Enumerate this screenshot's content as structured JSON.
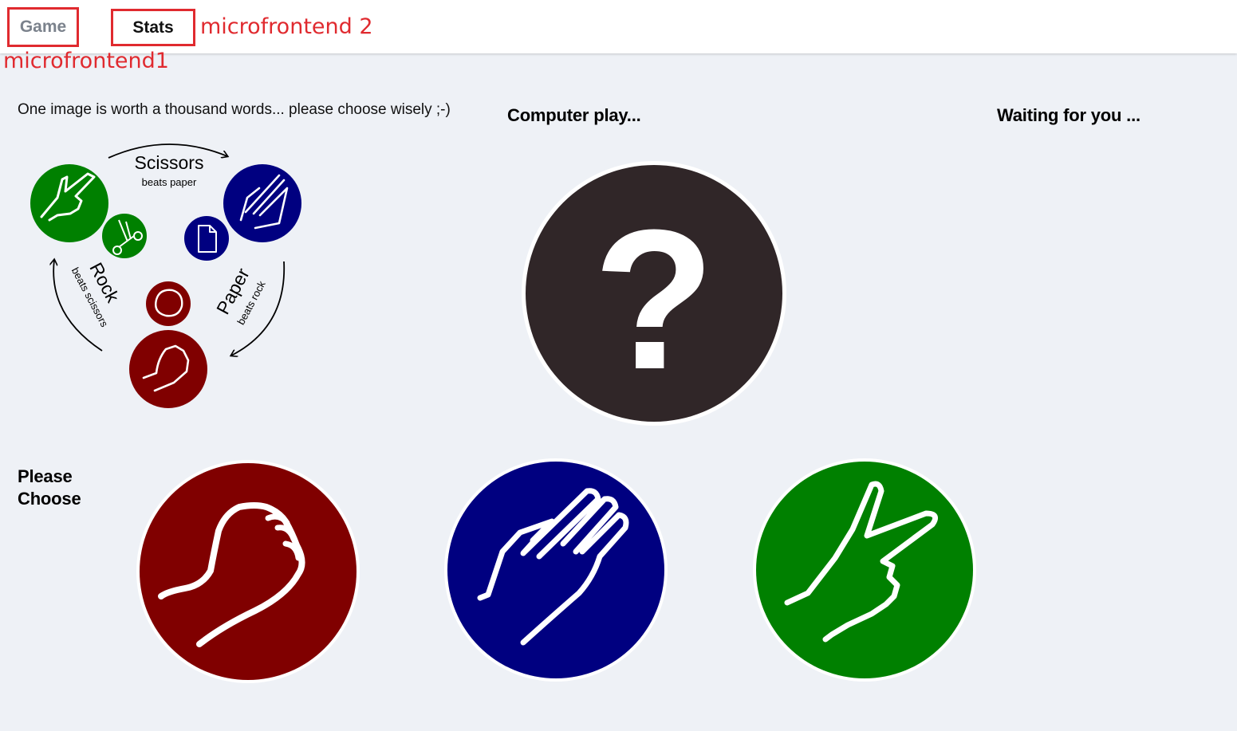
{
  "nav": {
    "tabs": [
      {
        "label": "Game"
      },
      {
        "label": "Stats"
      }
    ]
  },
  "annotations": {
    "microfrontend_1": "microfrontend1",
    "microfrontend_2": "microfrontend 2"
  },
  "intro": {
    "text": "One image is worth a thousand words... please choose wisely ;-)"
  },
  "diagram": {
    "scissors": {
      "label": "Scissors",
      "caption": "beats paper"
    },
    "rock": {
      "label": "Rock",
      "caption": "beats scissors"
    },
    "paper": {
      "label": "Paper",
      "caption": "beats rock"
    }
  },
  "computer": {
    "heading": "Computer play...",
    "symbol": "?"
  },
  "status": {
    "waiting": "Waiting for you ..."
  },
  "choose": {
    "heading": "Please Choose",
    "options": [
      {
        "name": "rock",
        "icon": "fist-icon"
      },
      {
        "name": "paper",
        "icon": "open-hand-icon"
      },
      {
        "name": "scissors",
        "icon": "v-sign-icon"
      }
    ]
  },
  "colors": {
    "rock": "#800000",
    "paper": "#000080",
    "scissors": "#008000",
    "mystery": "#302628",
    "annotation": "#e02a2f",
    "background": "#eef1f6"
  }
}
